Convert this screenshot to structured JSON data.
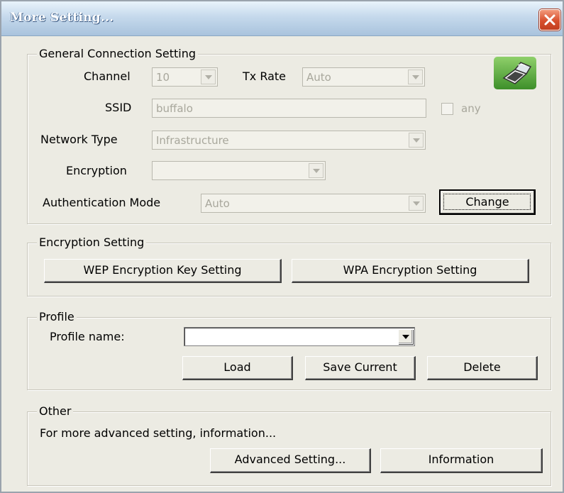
{
  "window": {
    "title": "More Setting..."
  },
  "general": {
    "legend": "General Connection Setting",
    "channel_label": "Channel",
    "channel_value": "10",
    "txrate_label": "Tx Rate",
    "txrate_value": "Auto",
    "ssid_label": "SSID",
    "ssid_value": "buffalo",
    "any_label": "any",
    "network_type_label": "Network Type",
    "network_type_value": "Infrastructure",
    "encryption_label": "Encryption",
    "encryption_value": "",
    "auth_label": "Authentication Mode",
    "auth_value": "Auto",
    "change_label": "Change"
  },
  "encryption_setting": {
    "legend": "Encryption Setting",
    "wep_label": "WEP Encryption Key Setting",
    "wpa_label": "WPA Encryption Setting"
  },
  "profile": {
    "legend": "Profile",
    "name_label": "Profile name:",
    "name_value": "",
    "load_label": "Load",
    "save_label": "Save Current",
    "delete_label": "Delete"
  },
  "other": {
    "legend": "Other",
    "description": "For more advanced setting, information...",
    "advanced_label": "Advanced Setting...",
    "information_label": "Information"
  },
  "colors": {
    "window_bg": "#ecebe3",
    "disabled_text": "#a8a79c",
    "close_button": "#d8502e"
  },
  "icons": [
    "close-icon",
    "laptop-icon",
    "dropdown-arrow-icon"
  ]
}
